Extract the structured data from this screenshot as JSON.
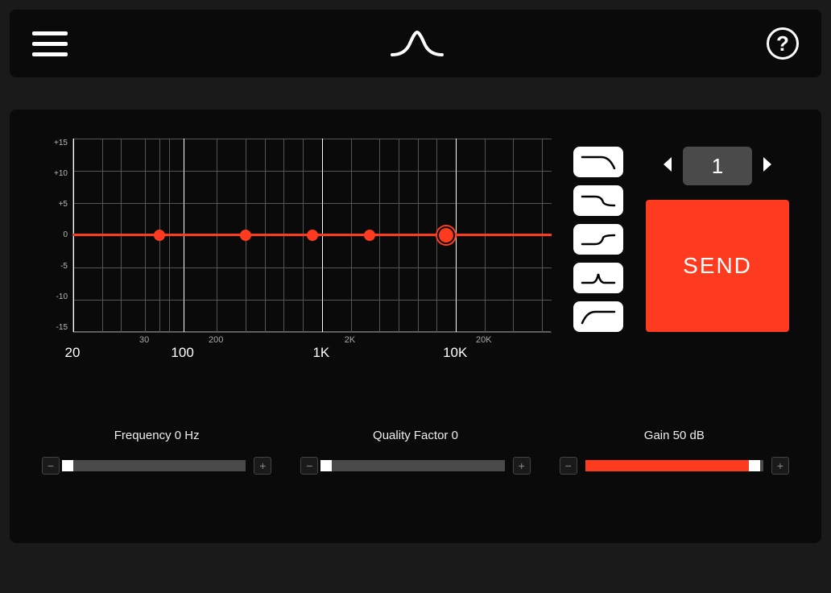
{
  "colors": {
    "accent": "#ff3b1f",
    "bg": "#1a1a1a",
    "panel": "#0a0a0a"
  },
  "header": {
    "menu_icon": "menu",
    "logo_icon": "peak-curve",
    "help_label": "?"
  },
  "graph": {
    "y_ticks": [
      "+15",
      "+10",
      "+5",
      "0",
      "-5",
      "-10",
      "-15"
    ],
    "x_major": [
      {
        "label": "20",
        "pos": 0
      },
      {
        "label": "100",
        "pos": 23
      },
      {
        "label": "1K",
        "pos": 52
      },
      {
        "label": "10K",
        "pos": 80
      }
    ],
    "x_minor": [
      {
        "label": "30",
        "pos": 15
      },
      {
        "label": "200",
        "pos": 30
      },
      {
        "label": "2K",
        "pos": 58
      },
      {
        "label": "20K",
        "pos": 86
      }
    ],
    "nodes": [
      {
        "pos": 18,
        "selected": false
      },
      {
        "pos": 36,
        "selected": false
      },
      {
        "pos": 50,
        "selected": false
      },
      {
        "pos": 62,
        "selected": false
      },
      {
        "pos": 78,
        "selected": true
      }
    ]
  },
  "filter_types": [
    "lowpass",
    "lowshelf",
    "highshelf",
    "peak",
    "highpass"
  ],
  "preset": {
    "value": "1"
  },
  "send": {
    "label": "SEND"
  },
  "sliders": {
    "frequency": {
      "label": "Frequency 0 Hz",
      "value_pct": 0
    },
    "quality": {
      "label": "Quality Factor 0",
      "value_pct": 0
    },
    "gain": {
      "label": "Gain 50 dB",
      "value_pct": 95
    }
  }
}
